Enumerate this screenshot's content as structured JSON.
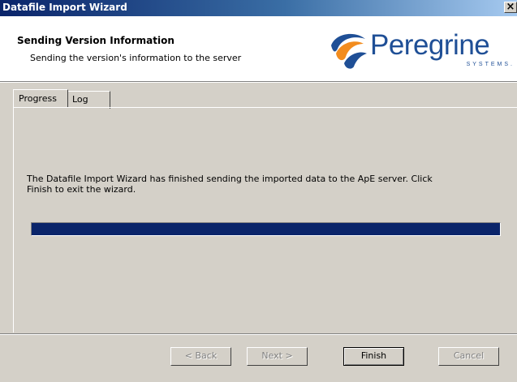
{
  "window": {
    "title": "Datafile Import Wizard",
    "close_glyph": "×"
  },
  "header": {
    "title": "Sending Version Information",
    "subtitle": "Sending the version's information to the server",
    "logo_text": "Peregrine",
    "logo_subtext": "SYSTEMS."
  },
  "tabs": [
    {
      "label": "Progress",
      "active": true
    },
    {
      "label": "Log",
      "active": false
    }
  ],
  "main": {
    "message": "The Datafile Import Wizard has finished sending the imported data to the ApE server.  Click Finish to exit the wizard.",
    "progress_percent": 100
  },
  "buttons": {
    "back": "< Back",
    "next": "Next >",
    "finish": "Finish",
    "cancel": "Cancel"
  },
  "colors": {
    "titlebar": "#0a246a",
    "progress_fill": "#0a246a",
    "logo_blue": "#1f4f96",
    "logo_orange": "#f28c1e"
  }
}
